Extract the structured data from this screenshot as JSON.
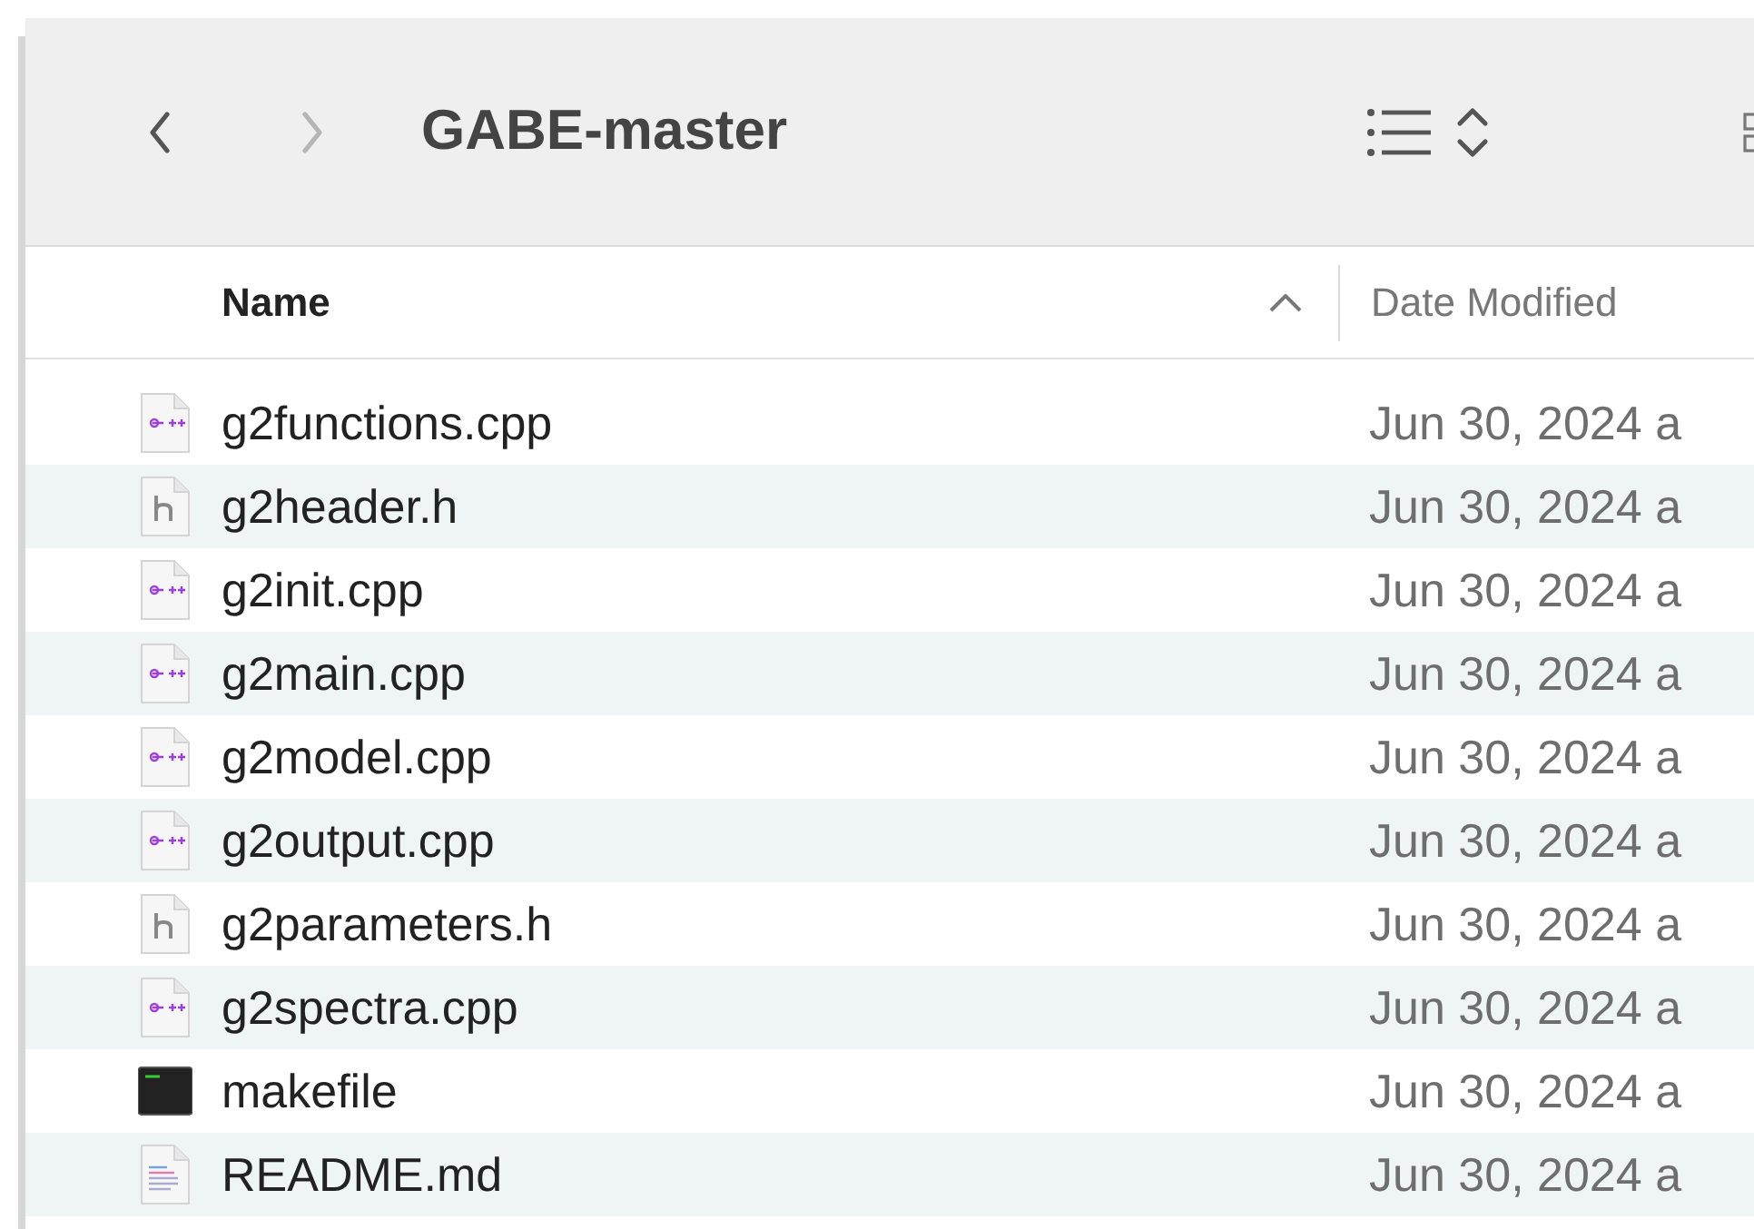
{
  "toolbar": {
    "back": {
      "disabled": false
    },
    "forward": {
      "disabled": true
    },
    "title": "GABE-master"
  },
  "columns": [
    {
      "label": "Name",
      "sorted": true
    },
    {
      "label": "Date Modified",
      "sorted": false
    }
  ],
  "files": [
    {
      "name": "g2functions.cpp",
      "kind": "cpp",
      "date": "Jun 30, 2024 a"
    },
    {
      "name": "g2header.h",
      "kind": "header",
      "date": "Jun 30, 2024 a"
    },
    {
      "name": "g2init.cpp",
      "kind": "cpp",
      "date": "Jun 30, 2024 a"
    },
    {
      "name": "g2main.cpp",
      "kind": "cpp",
      "date": "Jun 30, 2024 a"
    },
    {
      "name": "g2model.cpp",
      "kind": "cpp",
      "date": "Jun 30, 2024 a"
    },
    {
      "name": "g2output.cpp",
      "kind": "cpp",
      "date": "Jun 30, 2024 a"
    },
    {
      "name": "g2parameters.h",
      "kind": "header",
      "date": "Jun 30, 2024 a"
    },
    {
      "name": "g2spectra.cpp",
      "kind": "cpp",
      "date": "Jun 30, 2024 a"
    },
    {
      "name": "makefile",
      "kind": "terminal",
      "date": "Jun 30, 2024 a"
    },
    {
      "name": "README.md",
      "kind": "text",
      "date": "Jun 30, 2024 a"
    }
  ]
}
